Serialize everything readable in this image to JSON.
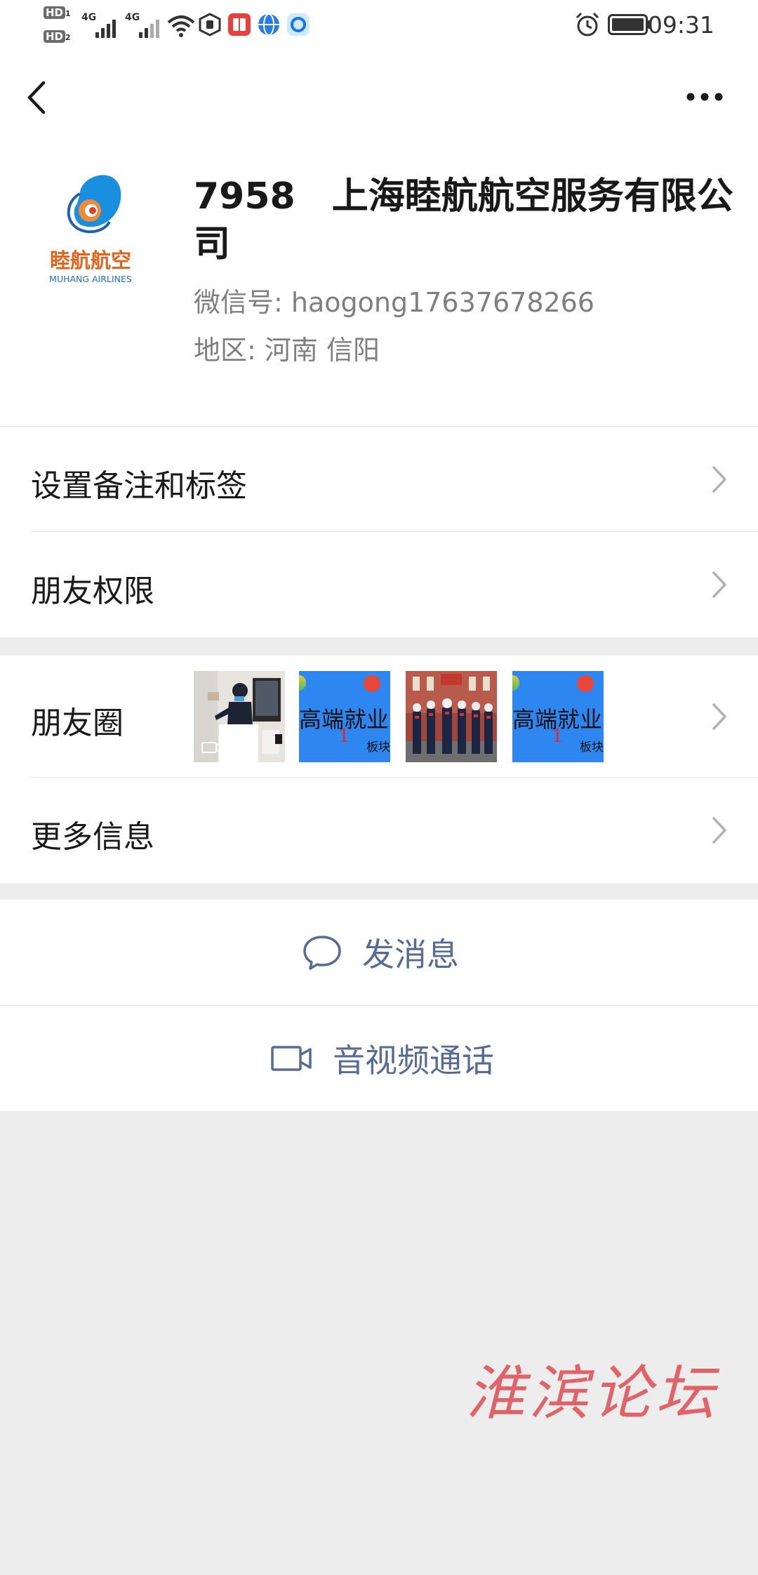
{
  "status_bar": {
    "hd1": "HD",
    "hd1_sub": "1",
    "hd2": "HD",
    "hd2_sub": "2",
    "net1": "4G",
    "net2": "4G",
    "time": "09:31",
    "icons": [
      "signal-icon",
      "wifi-icon",
      "vpn-icon",
      "app-notification-icon",
      "browser-icon",
      "app-icon",
      "alarm-icon",
      "battery-icon"
    ]
  },
  "nav": {
    "back_icon": "chevron-left-icon",
    "more_icon": "more-dots-icon"
  },
  "profile": {
    "avatar_brand_cn": "睦航航空",
    "avatar_brand_en": "MUHANG AIRLINES",
    "name": "7958　上海睦航航空服务有限公司",
    "wechat_id": "微信号: haogong17637678266",
    "region": "地区: 河南  信阳"
  },
  "rows": {
    "remark_label": "设置备注和标签",
    "permission_label": "朋友权限",
    "moments_label": "朋友圈",
    "more_info_label": "更多信息"
  },
  "moments_thumbs": [
    {
      "kind": "video",
      "caption": ""
    },
    {
      "kind": "image",
      "caption": "高端就业",
      "num": "1",
      "sub": "板块"
    },
    {
      "kind": "image",
      "caption": ""
    },
    {
      "kind": "image",
      "caption": "高端就业",
      "num": "1",
      "sub": "板块"
    }
  ],
  "actions": {
    "send_message": "发消息",
    "av_call": "音视频通话"
  },
  "watermark": "淮滨论坛",
  "colors": {
    "link_blue": "#576b95",
    "bg_gray": "#ededed",
    "thumb_blue": "#2e86f0",
    "watermark_red": "#e05058"
  }
}
